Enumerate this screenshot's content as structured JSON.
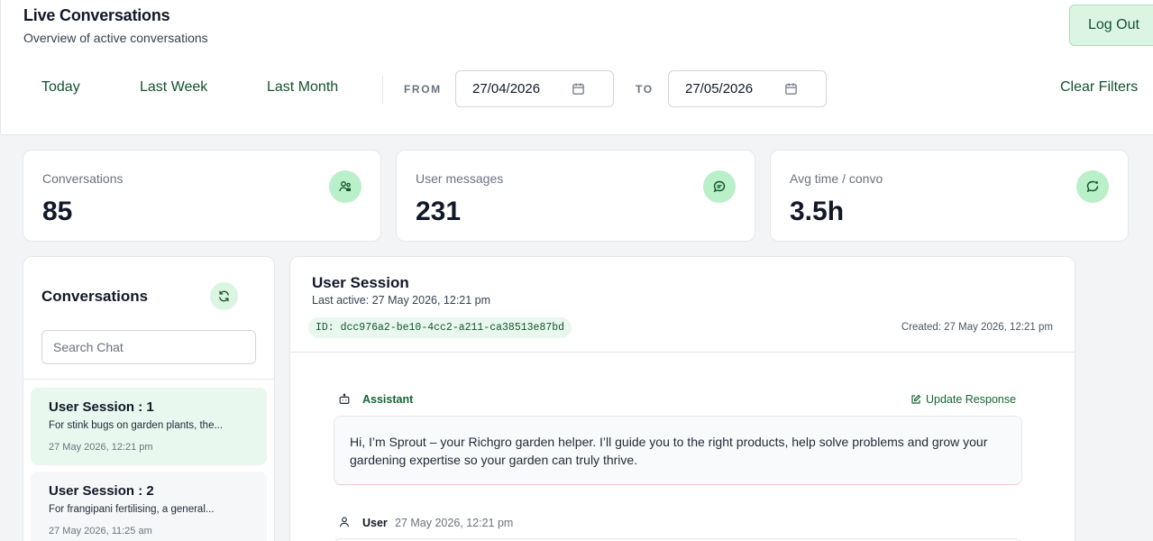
{
  "header": {
    "title": "Live Conversations",
    "subtitle": "Overview of active conversations",
    "logout_label": "Log Out"
  },
  "filters": {
    "ranges": [
      "Today",
      "Last Week",
      "Last Month"
    ],
    "from_label": "FROM",
    "from_value": "27/04/2026",
    "to_label": "TO",
    "to_value": "27/05/2026",
    "clear_label": "Clear Filters"
  },
  "stats": [
    {
      "label": "Conversations",
      "value": "85",
      "icon": "users-icon"
    },
    {
      "label": "User messages",
      "value": "231",
      "icon": "chat-bubble-icon"
    },
    {
      "label": "Avg time / convo",
      "value": "3.5h",
      "icon": "chat-clock-icon"
    }
  ],
  "conversations": {
    "title": "Conversations",
    "search_placeholder": "Search Chat",
    "items": [
      {
        "name": "User Session : 1",
        "preview": "For stink bugs on garden plants, the...",
        "time": "27 May 2026, 12:21 pm",
        "active": true
      },
      {
        "name": "User Session : 2",
        "preview": "For frangipani fertilising, a general...",
        "time": "27 May 2026, 11:25 am",
        "active": false
      }
    ]
  },
  "session": {
    "title": "User Session",
    "last_active": "Last active: 27 May 2026, 12:21 pm",
    "id": "ID: dcc976a2-be10-4cc2-a211-ca38513e87bd",
    "created": "Created: 27 May 2026, 12:21 pm",
    "messages": [
      {
        "role": "Assistant",
        "action": "Update Response",
        "text": "Hi, I’m Sprout – your Richgro garden helper. I’ll guide you to the right products, help solve problems and grow your gardening expertise so your garden can truly thrive."
      },
      {
        "role": "User",
        "time": "27 May 2026, 12:21 pm"
      }
    ]
  },
  "colors": {
    "accent": "#14532d",
    "accent_light": "#dcf5e3",
    "icon_bg": "#b9efc9",
    "page_bg": "#f3f4f5"
  }
}
